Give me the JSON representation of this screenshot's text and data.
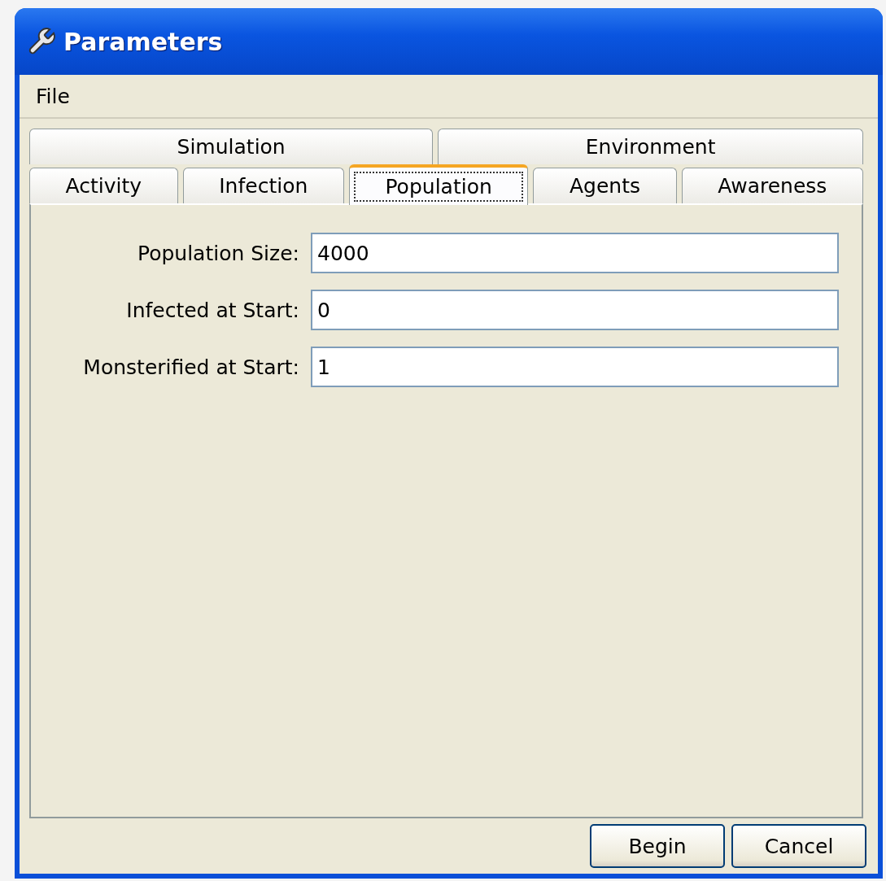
{
  "window": {
    "title": "Parameters"
  },
  "menu": [
    {
      "label": "File"
    }
  ],
  "tab_rows": [
    [
      {
        "label": "Simulation",
        "selected": false
      },
      {
        "label": "Environment",
        "selected": false
      }
    ],
    [
      {
        "label": "Activity",
        "selected": false
      },
      {
        "label": "Infection",
        "selected": false
      },
      {
        "label": "Population",
        "selected": true
      },
      {
        "label": "Agents",
        "selected": false
      },
      {
        "label": "Awareness",
        "selected": false
      }
    ]
  ],
  "fields": [
    {
      "label": "Population Size:",
      "value": "4000"
    },
    {
      "label": "Infected at Start:",
      "value": "0"
    },
    {
      "label": "Monsterified at Start:",
      "value": "1"
    }
  ],
  "buttons": [
    {
      "label": "Begin"
    },
    {
      "label": "Cancel"
    }
  ]
}
